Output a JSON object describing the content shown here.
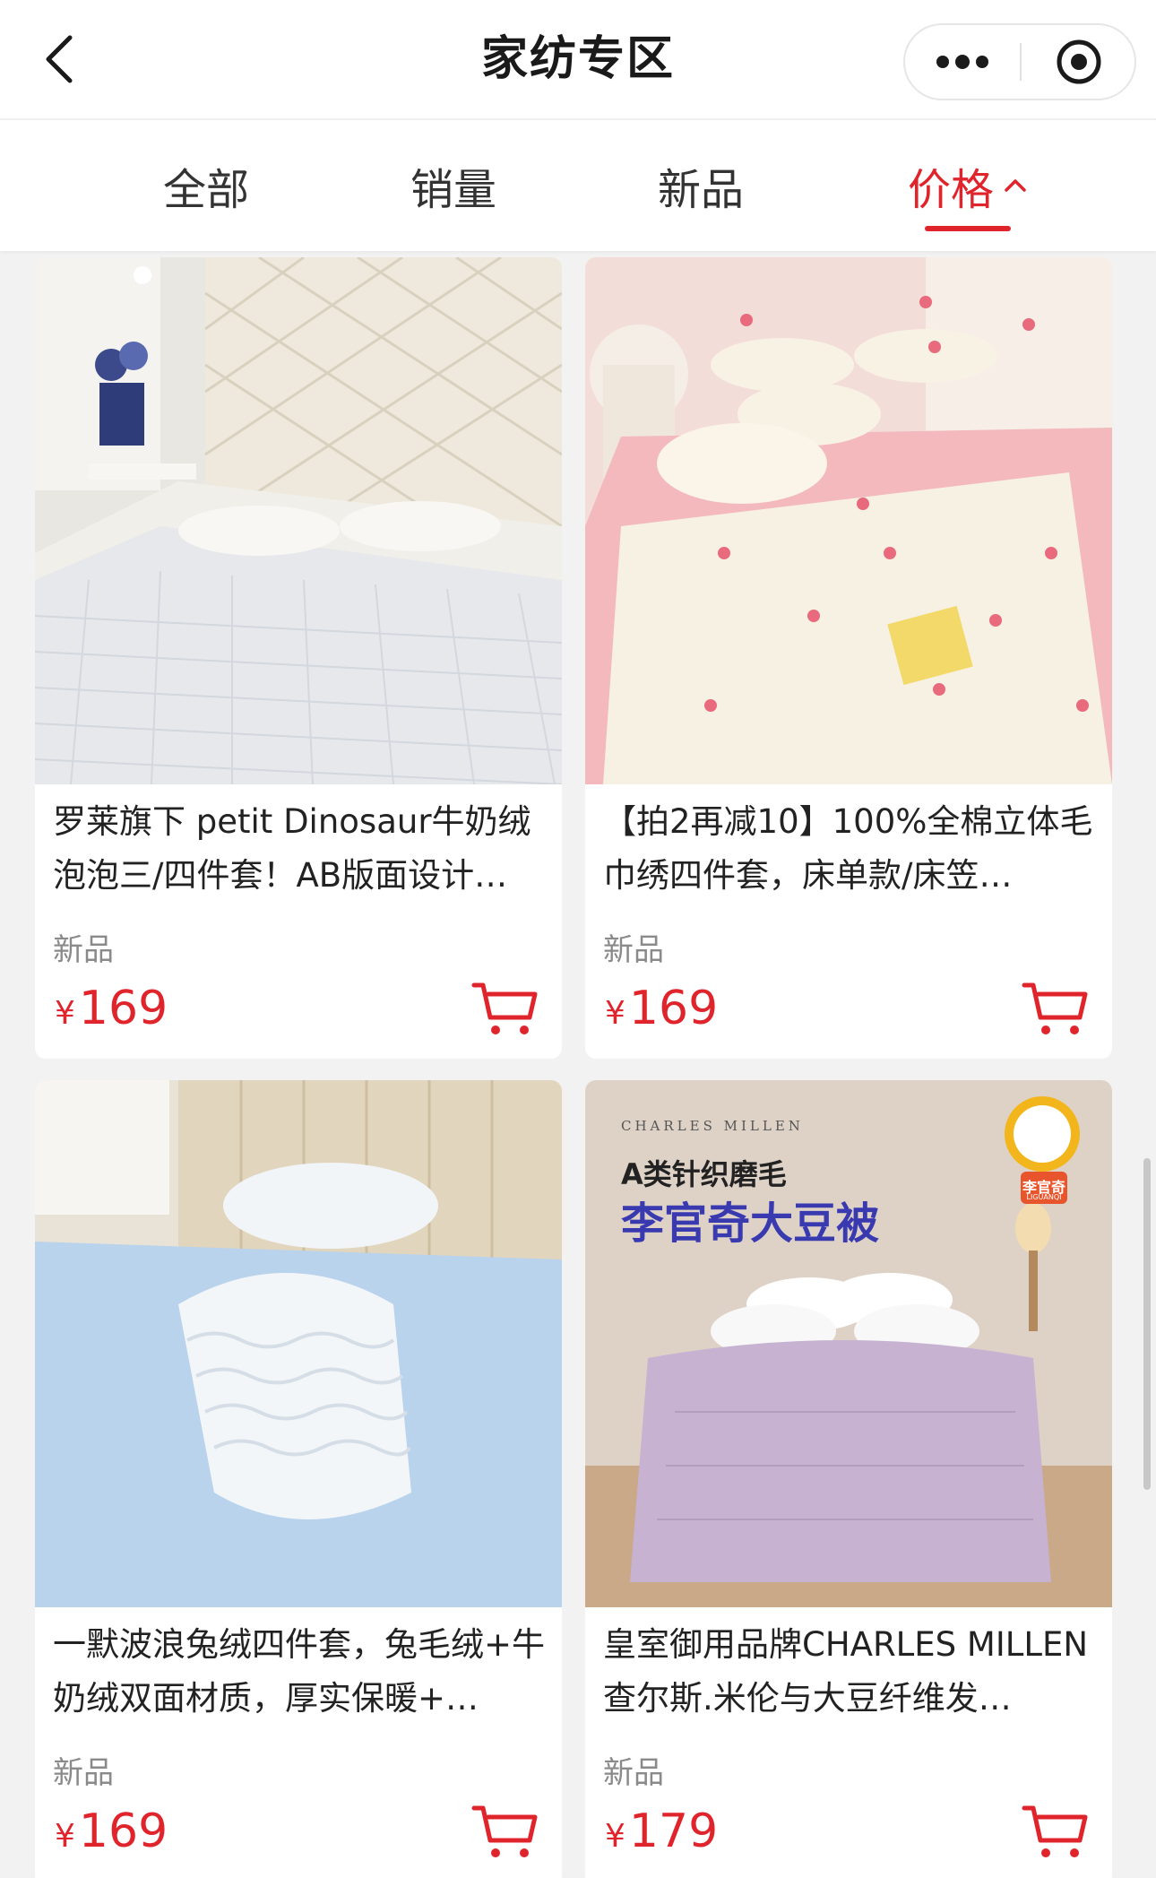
{
  "nav": {
    "title": "家纺专区",
    "back_icon": "chevron-left-icon",
    "more_icon": "more-dots-icon",
    "close_icon": "target-close-icon"
  },
  "tabs": [
    {
      "label": "全部",
      "active": false
    },
    {
      "label": "销量",
      "active": false
    },
    {
      "label": "新品",
      "active": false
    },
    {
      "label": "价格",
      "active": true,
      "sort": "ascending"
    }
  ],
  "colors": {
    "accent": "#e0242c",
    "background": "#f2f2f2"
  },
  "products": [
    {
      "title": "罗莱旗下 petit Dinosaur牛奶绒泡泡三/四件套！AB版面设计…",
      "tag": "新品",
      "currency": "¥",
      "price": "169",
      "image": "white-quilted-bedding-photo",
      "cart_icon": "cart-icon"
    },
    {
      "title": "【拍2再减10】100%全棉立体毛巾绣四件套，床单款/床笠…",
      "tag": "新品",
      "currency": "¥",
      "price": "169",
      "image": "pink-floral-bedding-photo",
      "cart_icon": "cart-icon"
    },
    {
      "title": "一默波浪兔绒四件套，兔毛绒+牛奶绒双面材质，厚实保暖+…",
      "tag": "新品",
      "currency": "¥",
      "price": "169",
      "image": "blue-wave-plush-bedding-photo",
      "cart_icon": "cart-icon"
    },
    {
      "title": "皇室御用品牌CHARLES MILLEN 查尔斯.米伦与大豆纤维发…",
      "tag": "新品",
      "currency": "¥",
      "price": "179",
      "image": "purple-soybean-quilt-photo",
      "cart_icon": "cart-icon",
      "banner": {
        "brand": "CHARLES MILLEN",
        "line1": "A类针织磨毛",
        "line2": "李官奇大豆被",
        "badge": "李官奇",
        "badge_sub": "LIGUANQI"
      }
    }
  ]
}
